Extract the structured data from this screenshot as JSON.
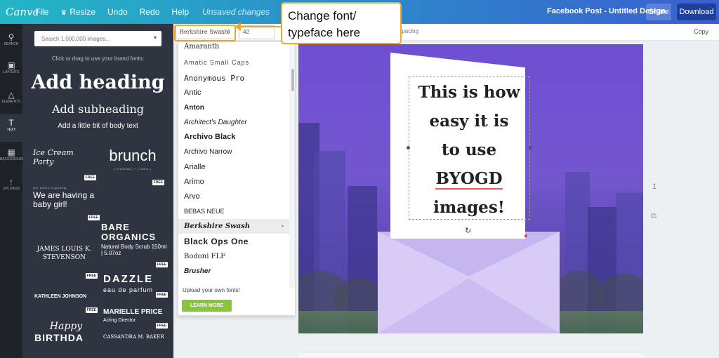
{
  "app": {
    "logo": "Canva",
    "menu": [
      "File",
      "Resize",
      "Undo",
      "Redo",
      "Help"
    ],
    "unsaved": "Unsaved changes",
    "design_title": "Facebook Post - Untitled Design",
    "share_label": "Share",
    "download_label": "Download",
    "brand_colors": {
      "bar_start": "#24b6c6",
      "bar_end": "#3a5fcf",
      "accent": "#f5a623"
    }
  },
  "rail": [
    {
      "label": "SEARCH",
      "icon": "search-icon"
    },
    {
      "label": "LAYOUTS",
      "icon": "layouts-icon"
    },
    {
      "label": "ELEMENTS",
      "icon": "elements-icon"
    },
    {
      "label": "TEXT",
      "icon": "text-icon"
    },
    {
      "label": "BACKGROUND",
      "icon": "background-icon"
    },
    {
      "label": "UPLOADS",
      "icon": "uploads-icon"
    }
  ],
  "panel": {
    "search_placeholder": "Search 1,000,000 images...",
    "brand_hint": "Click or drag to use your brand fonts:",
    "add_heading": "Add heading",
    "add_subheading": "Add subheading",
    "add_body": "Add a little bit of body text",
    "free": "FREE",
    "thumbs": {
      "ice_cream": "Ice Cream Party",
      "brunch": "brunch",
      "brunch_sub": "[ breakfast ] + [ lunch ]",
      "our_family": "Our family is growing",
      "having_girl": "We are having a baby girl!",
      "bare": "BARE ORGANICS",
      "bare_sub": "Natural Body Scrub 150ml | 5.07oz",
      "james": "JAMES LOUIS K. STEVENSON",
      "dazzle": "DAZZLE",
      "dazzle_sub": "eau de parfum",
      "kathleen": "KATHLEEN JOHNSON",
      "marielle": "MARIELLE PRICE",
      "marielle_sub": "Acting Director",
      "happy": "Happy",
      "birthday": "BIRTHDA",
      "cassandra": "CASSANDRA M. BAKER"
    }
  },
  "toolbar": {
    "font_value": "Berkshire Swash",
    "size_value": "42",
    "spacing": "Spacing",
    "copy": "Copy"
  },
  "font_list": {
    "items": [
      "Amaranth",
      "Amatic Small Caps",
      "Anonymous Pro",
      "Antic",
      "Anton",
      "Architect's Daughter",
      "Archivo Black",
      "Archivo Narrow",
      "Arialle",
      "Arimo",
      "Arvo",
      "BEBAS NEUE",
      "Berkshire Swash",
      "Black Ops One",
      "Bodoni FLF",
      "Brusher"
    ],
    "hovered": "Berkshire Swash",
    "upload_text": "Upload your own fonts!",
    "learn_more": "LEARN MORE"
  },
  "design": {
    "lines": [
      "This is how",
      "easy it is",
      "to use",
      "BYOGD",
      "images!"
    ],
    "page_number": "1"
  },
  "callout": {
    "line1": "Change font/",
    "line2": "typeface here"
  }
}
